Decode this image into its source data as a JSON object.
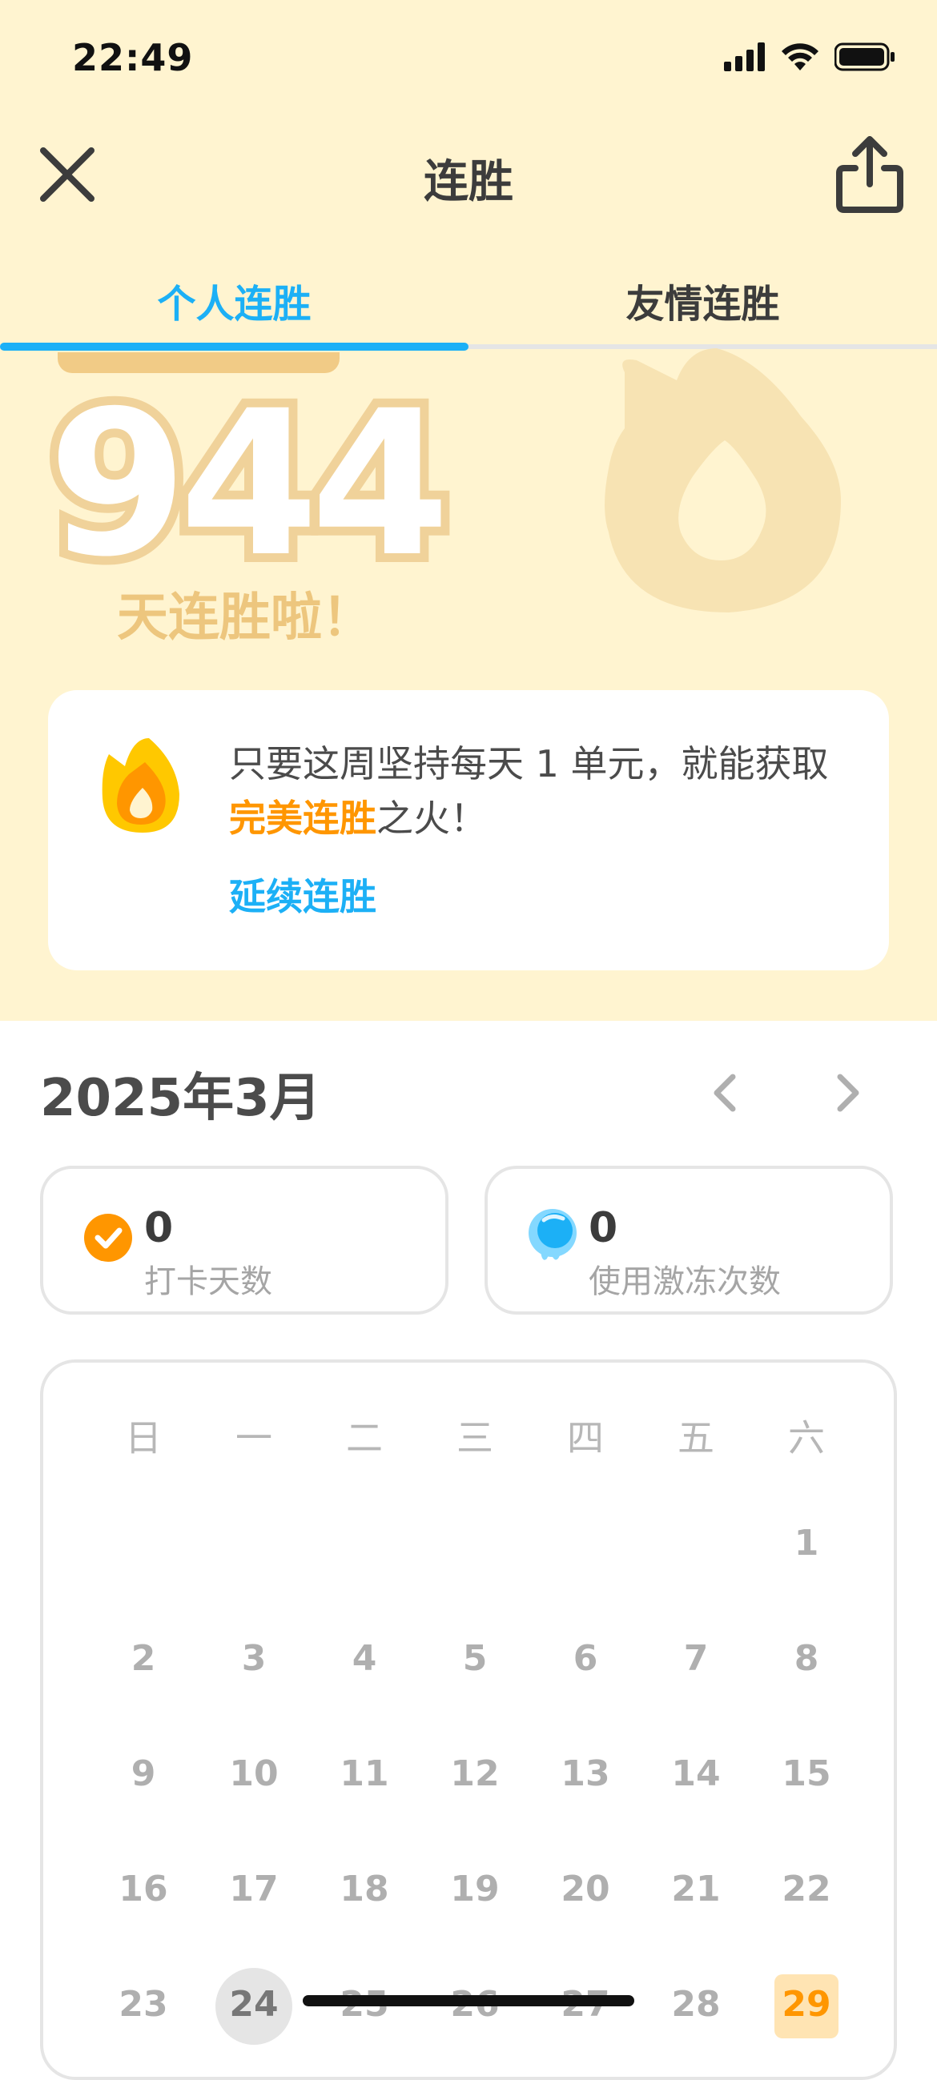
{
  "status_bar": {
    "time": "22:49"
  },
  "nav": {
    "title": "连胜"
  },
  "tabs": [
    {
      "label": "个人连胜",
      "active": true
    },
    {
      "label": "友情连胜",
      "active": false
    }
  ],
  "hero": {
    "streak_number": "944",
    "label": "天连胜啦！"
  },
  "promo": {
    "text_before": "只要这周坚持每天 1 单元，就能获取",
    "text_highlight": "完美连胜",
    "text_after": "之火！",
    "link": "延续连胜"
  },
  "month": {
    "title": "2025年3月"
  },
  "stats": {
    "checkin": {
      "value": "0",
      "label": "打卡天数"
    },
    "freeze": {
      "value": "0",
      "label": "使用激冻次数"
    }
  },
  "calendar": {
    "weekdays": [
      "日",
      "一",
      "二",
      "三",
      "四",
      "五",
      "六"
    ],
    "weeks": [
      [
        "",
        "",
        "",
        "",
        "",
        "",
        "1"
      ],
      [
        "2",
        "3",
        "4",
        "5",
        "6",
        "7",
        "8"
      ],
      [
        "9",
        "10",
        "11",
        "12",
        "13",
        "14",
        "15"
      ],
      [
        "16",
        "17",
        "18",
        "19",
        "20",
        "21",
        "22"
      ],
      [
        "23",
        "24",
        "25",
        "26",
        "27",
        "28",
        "29"
      ]
    ],
    "today": "24",
    "streak_day": "29"
  },
  "colors": {
    "accent_blue": "#1cb0f6",
    "accent_orange": "#ff9600",
    "hero_bg": "#fff4d0"
  }
}
